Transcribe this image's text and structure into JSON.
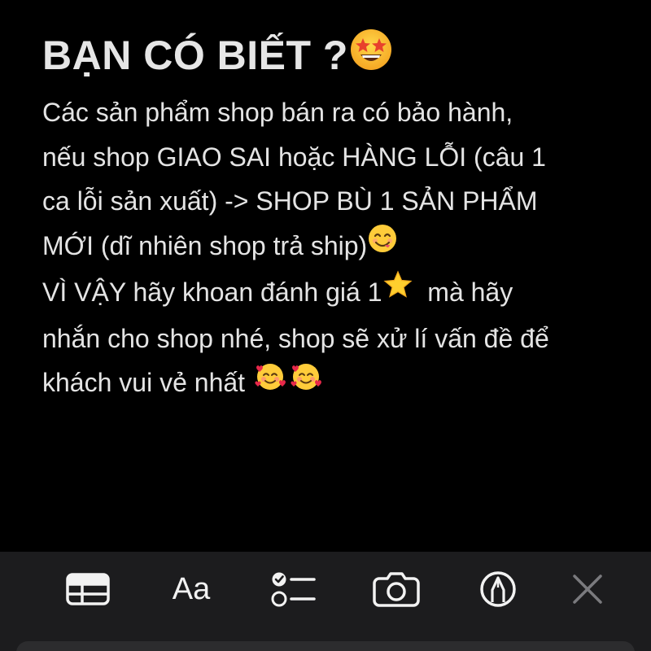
{
  "note": {
    "title": "BẠN CÓ BIẾT ?",
    "lines": [
      "Các sản phẩm shop bán ra có bảo hành,",
      "nếu shop GIAO SAI hoặc HÀNG LỖI (câu 1",
      "ca lỗi sản xuất) -> SHOP BÙ 1 SẢN PHẨM",
      "MỚI (dĩ nhiên shop trả ship)",
      "VÌ VẬY hãy khoan đánh giá 1",
      "mà hãy",
      "nhắn cho shop nhé, shop sẽ xử lí vấn đề để",
      "khách vui vẻ nhất"
    ],
    "emojis": {
      "title": "star-struck-emoji",
      "line4": "yum-face-emoji",
      "line5": "star-emoji",
      "line8": "smiling-face-with-hearts-emoji"
    }
  },
  "toolbar": {
    "items": [
      {
        "name": "table-icon"
      },
      {
        "name": "text-format",
        "label": "Aa"
      },
      {
        "name": "checklist-icon"
      },
      {
        "name": "camera-icon"
      },
      {
        "name": "markup-pen-icon"
      },
      {
        "name": "close-icon"
      }
    ]
  },
  "colors": {
    "background": "#000000",
    "toolbar": "#1c1c1e",
    "text": "#e4e4e4",
    "icon": "#f2f2f2",
    "icon_dim": "#7a7a7e"
  }
}
